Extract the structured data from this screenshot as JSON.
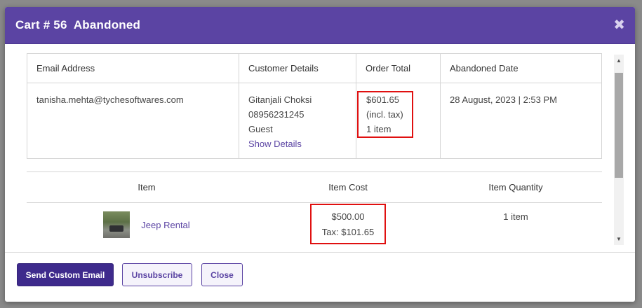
{
  "modal": {
    "title": "Cart # 56  Abandoned",
    "close_icon": "close-icon"
  },
  "cart_table": {
    "headers": [
      "Email Address",
      "Customer Details",
      "Order Total",
      "Abandoned Date"
    ],
    "email": "tanisha.mehta@tychesoftwares.com",
    "customer": {
      "name": "Gitanjali Choksi",
      "phone": "08956231245",
      "type": "Guest",
      "show_details": "Show Details"
    },
    "order_total": {
      "amount": "$601.65",
      "tax_note": "(incl. tax)",
      "items": "1 item"
    },
    "abandoned_date": "28 August, 2023 | 2:53 PM"
  },
  "items_table": {
    "headers": [
      "Item",
      "Item Cost",
      "Item Quantity"
    ],
    "rows": [
      {
        "name": "Jeep Rental",
        "cost": "$500.00",
        "tax": "Tax: $101.65",
        "quantity": "1 item"
      }
    ]
  },
  "footer": {
    "send_email": "Send Custom Email",
    "unsubscribe": "Unsubscribe",
    "close": "Close"
  },
  "colors": {
    "header_bg": "#5b44a3",
    "primary_button": "#3e2a8c",
    "highlight_border": "#e01010"
  }
}
